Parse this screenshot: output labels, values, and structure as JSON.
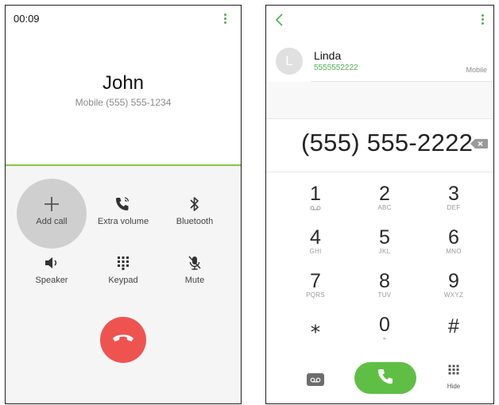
{
  "in_call": {
    "timer": "00:09",
    "caller_name": "John",
    "caller_info": "Mobile  (555) 555-1234",
    "actions": [
      {
        "label": "Add call",
        "icon": "plus-icon"
      },
      {
        "label": "Extra volume",
        "icon": "phone-volume-icon"
      },
      {
        "label": "Bluetooth",
        "icon": "bluetooth-icon"
      },
      {
        "label": "Speaker",
        "icon": "speaker-icon"
      },
      {
        "label": "Keypad",
        "icon": "keypad-icon"
      },
      {
        "label": "Mute",
        "icon": "mute-mic-icon"
      }
    ],
    "end_call_icon": "end-call-icon",
    "end_call_color": "#ef5350",
    "accent_color": "#8bc34a"
  },
  "dialer": {
    "contact": {
      "initial": "L",
      "name": "Linda",
      "number": "5555552222",
      "type": "Mobile"
    },
    "dialed_number": "(555) 555-2222",
    "keys": [
      {
        "digit": "1",
        "sub": ""
      },
      {
        "digit": "2",
        "sub": "ABC"
      },
      {
        "digit": "3",
        "sub": "DEF"
      },
      {
        "digit": "4",
        "sub": "GHI"
      },
      {
        "digit": "5",
        "sub": "JKL"
      },
      {
        "digit": "6",
        "sub": "MNO"
      },
      {
        "digit": "7",
        "sub": "PQRS"
      },
      {
        "digit": "8",
        "sub": "TUV"
      },
      {
        "digit": "9",
        "sub": "WXYZ"
      },
      {
        "digit": "⁎",
        "sub": ""
      },
      {
        "digit": "0",
        "sub": "+"
      },
      {
        "digit": "#",
        "sub": ""
      }
    ],
    "hide_label": "Hide",
    "call_color": "#5fbf45",
    "accent_color": "#4caf50"
  }
}
